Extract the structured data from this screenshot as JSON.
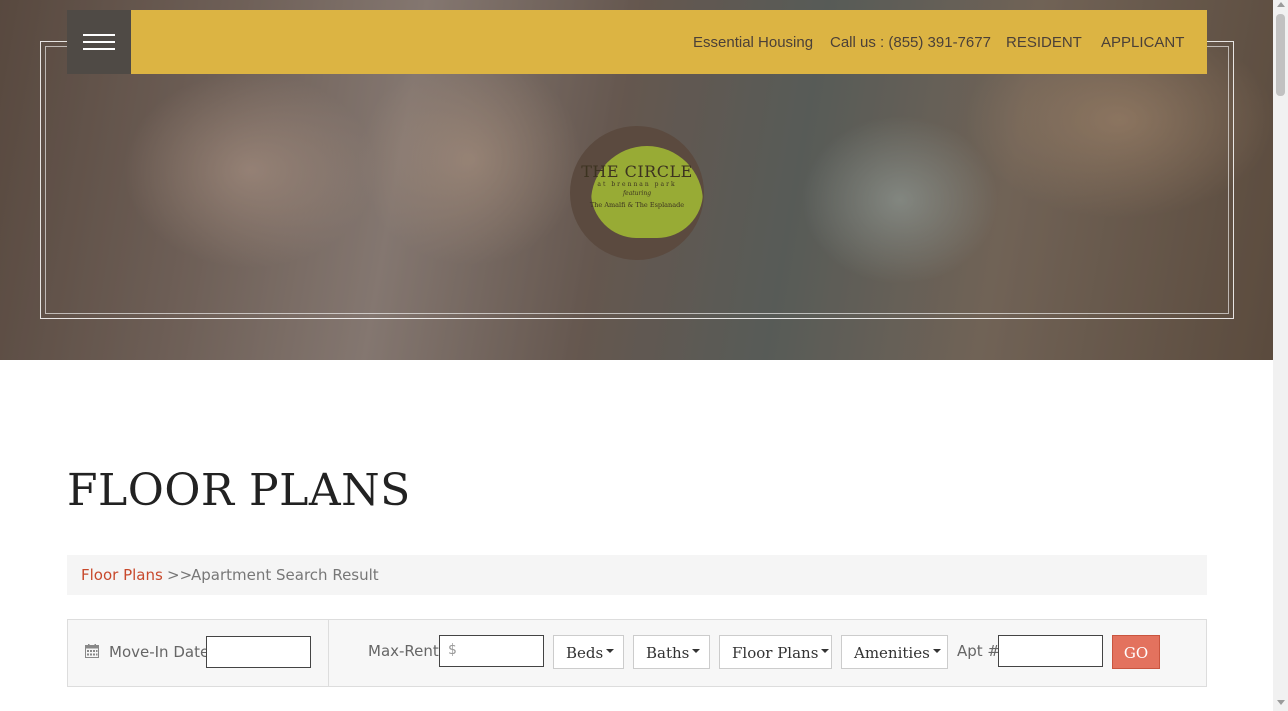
{
  "header": {
    "menu_icon": "hamburger-menu-icon",
    "nav": {
      "essential_housing": "Essential Housing",
      "call_us": "Call us : (855) 391-7677",
      "resident": "RESIDENT",
      "applicant": "APPLICANT"
    },
    "colors": {
      "topbar": "#dcb443",
      "menu_button": "#4f4a45"
    }
  },
  "hero": {
    "logo": {
      "title": "THE CIRCLE",
      "subtitle": "at brennan park",
      "featuring": "featuring",
      "line": "The Amalfi & The Esplanade",
      "colors": {
        "ring": "#5b4a3f",
        "disc": "#98ab35"
      }
    }
  },
  "main": {
    "title": "FLOOR PLANS",
    "breadcrumb": {
      "link": "Floor Plans",
      "separator": ">>",
      "current": "Apartment Search Result"
    },
    "filter": {
      "calendar_icon": "calendar-icon",
      "move_in_label": "Move-In Date",
      "move_in_value": "",
      "max_rent_label": "Max-Rent",
      "max_rent_placeholder": "$",
      "beds": "Beds",
      "baths": "Baths",
      "floor_plans": "Floor Plans",
      "amenities": "Amenities",
      "apt_label": "Apt #",
      "apt_value": "",
      "go": "GO",
      "colors": {
        "go_button": "#e3725e",
        "link": "#c8492c"
      }
    }
  }
}
